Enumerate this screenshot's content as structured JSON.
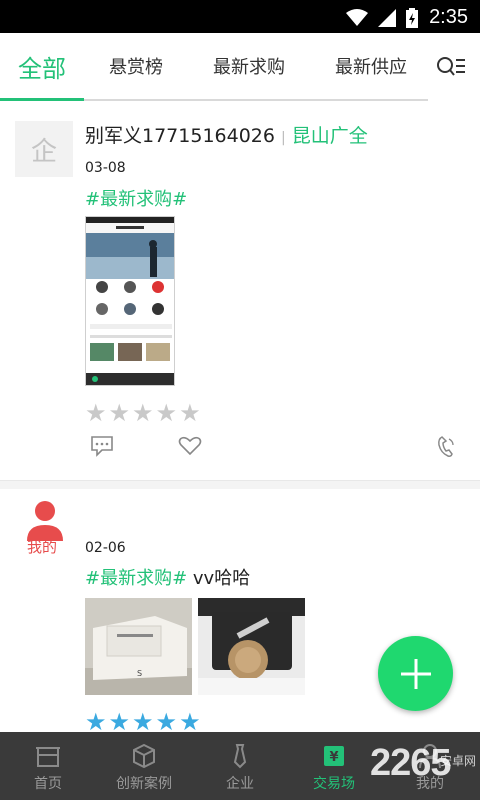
{
  "status_bar": {
    "time": "2:35"
  },
  "tabs": [
    {
      "label": "全部",
      "active": true
    },
    {
      "label": "悬赏榜",
      "active": false
    },
    {
      "label": "最新求购",
      "active": false
    },
    {
      "label": "最新供应",
      "active": false
    }
  ],
  "posts": [
    {
      "avatar_text": "企",
      "user": "别军义17715164026",
      "company": "昆山广全",
      "date": "03-08",
      "tag": "#最新求购#",
      "message": "",
      "rating": 0
    },
    {
      "avatar_label": "我的",
      "date": "02-06",
      "tag": "#最新求购#",
      "message": "vv哈哈",
      "rating": 5
    }
  ],
  "bottom_nav": [
    {
      "label": "首页",
      "icon": "home-icon",
      "active": false
    },
    {
      "label": "创新案例",
      "icon": "cube-icon",
      "active": false
    },
    {
      "label": "企业",
      "icon": "tie-icon",
      "active": false
    },
    {
      "label": "交易场",
      "icon": "trade-icon",
      "active": true
    },
    {
      "label": "我的",
      "icon": "person-icon",
      "active": false
    }
  ],
  "watermark": {
    "num": "2265",
    "text": "安卓网"
  },
  "colors": {
    "accent": "#23c178",
    "fab": "#1fd86f",
    "nav_bg": "#3a3a3a",
    "me_red": "#e74c4c",
    "star_blue": "#3aa9e0",
    "star_gray": "#c9c9c9"
  }
}
